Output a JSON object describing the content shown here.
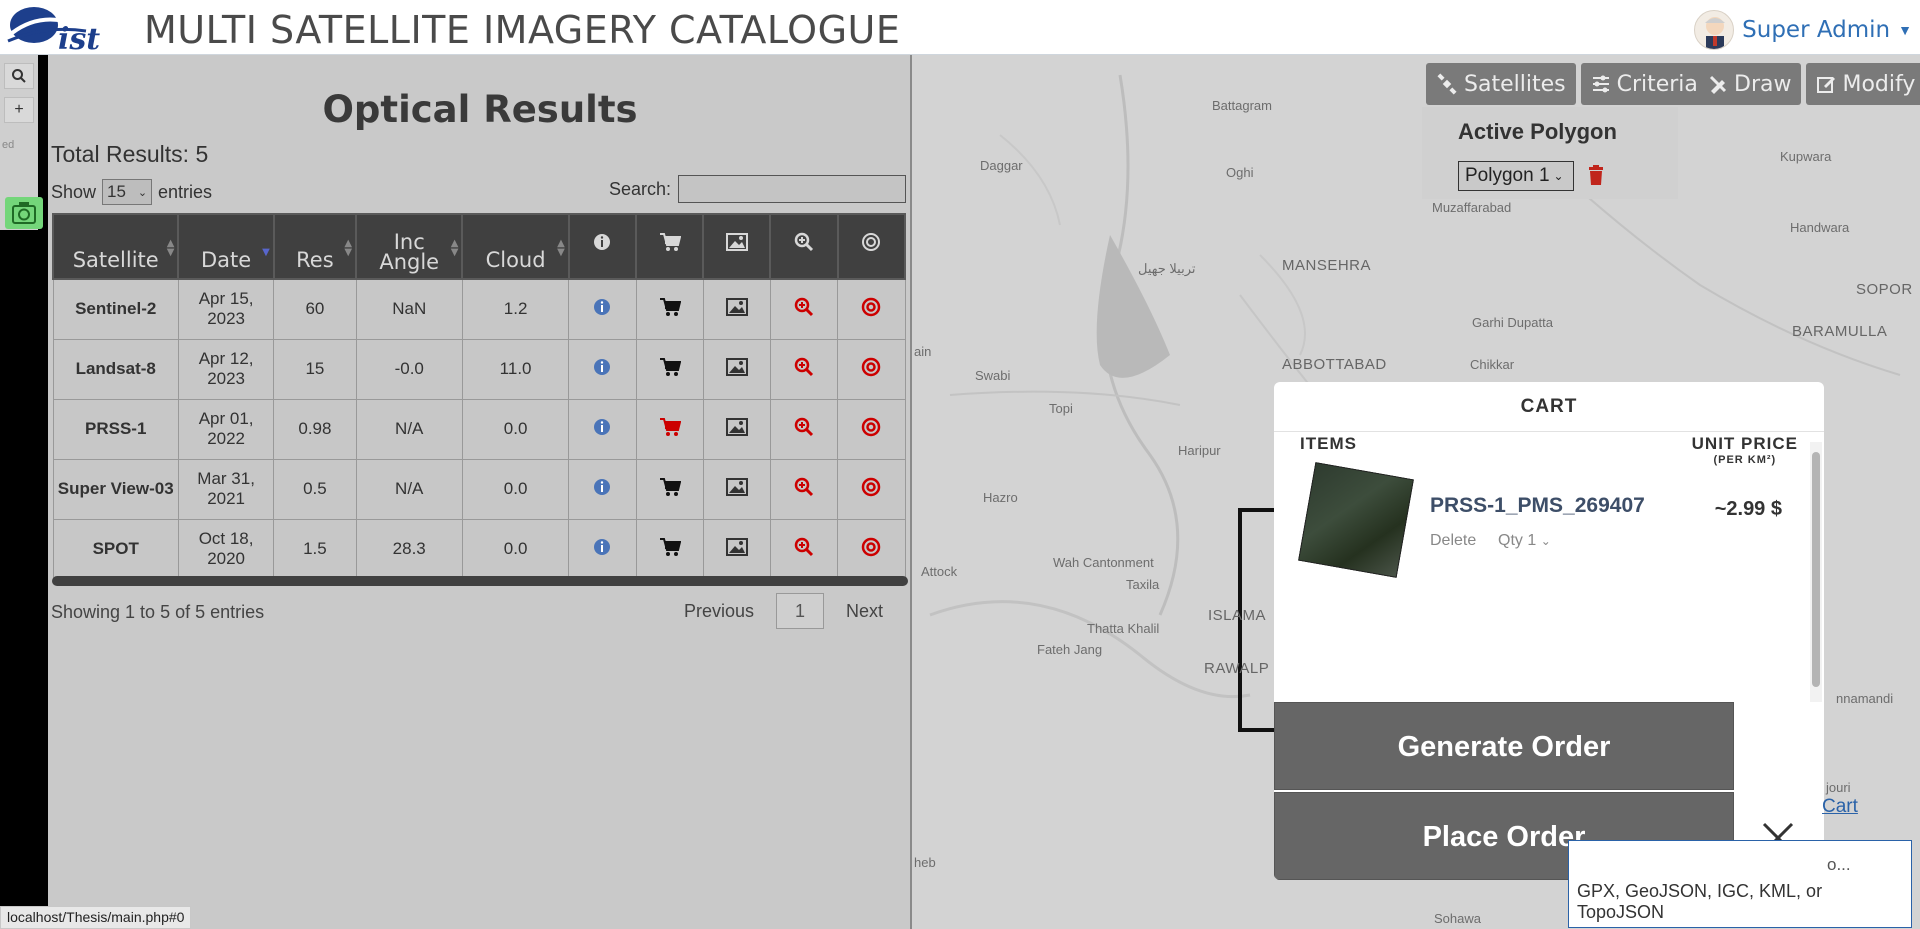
{
  "header": {
    "app_title": "MULTI SATELLITE IMAGERY CATALOGUE",
    "user_name": "Super Admin"
  },
  "map": {
    "place_labels": [
      {
        "text": "Battagram",
        "style": "small"
      },
      {
        "text": "Daggar",
        "style": "small"
      },
      {
        "text": "Oghi",
        "style": "small"
      },
      {
        "text": "Kupwara",
        "style": "small"
      },
      {
        "text": "Handwara",
        "style": "small"
      },
      {
        "text": "Muzaffarabad",
        "style": "small"
      },
      {
        "text": "MANSEHRA",
        "style": "big"
      },
      {
        "text": "Garhi Dupatta",
        "style": "small"
      },
      {
        "text": "SOPOR",
        "style": "big"
      },
      {
        "text": "BARAMULLA",
        "style": "big"
      },
      {
        "text": "ABBOTTABAD",
        "style": "big"
      },
      {
        "text": "Chikkar",
        "style": "small"
      },
      {
        "text": "Swabi",
        "style": "small"
      },
      {
        "text": "Topi",
        "style": "small"
      },
      {
        "text": "Haripur",
        "style": "small"
      },
      {
        "text": "Hazro",
        "style": "small"
      },
      {
        "text": "Attock",
        "style": "small"
      },
      {
        "text": "Wah Cantonment",
        "style": "small"
      },
      {
        "text": "Taxila",
        "style": "small"
      },
      {
        "text": "ISLAMA",
        "style": "big"
      },
      {
        "text": "RAWALP",
        "style": "big"
      },
      {
        "text": "Thatta Khalil",
        "style": "small"
      },
      {
        "text": "Fateh Jang",
        "style": "small"
      },
      {
        "text": "Sohawa",
        "style": "small"
      },
      {
        "text": "nnamandi",
        "style": "small"
      },
      {
        "text": "jouri",
        "style": "small"
      },
      {
        "text": "ain",
        "style": "small"
      },
      {
        "text": "heb",
        "style": "small"
      },
      {
        "text": "تربیلا جھیل",
        "style": "small"
      }
    ],
    "zoom_in_label": "+",
    "attribution_fragment": "ed"
  },
  "toolbar": {
    "satellites": "Satellites",
    "criteria": "Criteria",
    "draw": "Draw",
    "modify": "Modify"
  },
  "active_polygon": {
    "title": "Active Polygon",
    "selected": "Polygon 1"
  },
  "results": {
    "title": "Optical Results",
    "total": "Total Results: 5",
    "show_label": "Show",
    "entries_value": "15",
    "entries_label": "entries",
    "search_label": "Search:",
    "columns": [
      "Satellite",
      "Date",
      "Res",
      "Inc Angle",
      "Cloud"
    ],
    "icon_columns": [
      "info-icon",
      "cart-icon",
      "image-icon",
      "zoom-icon",
      "target-icon"
    ],
    "rows": [
      {
        "satellite": "Sentinel-2",
        "date": "Apr 15, 2023",
        "res": "60",
        "inc": "NaN",
        "cloud": "1.2",
        "in_cart": false
      },
      {
        "satellite": "Landsat-8",
        "date": "Apr 12, 2023",
        "res": "15",
        "inc": "-0.0",
        "cloud": "11.0",
        "in_cart": false
      },
      {
        "satellite": "PRSS-1",
        "date": "Apr 01, 2022",
        "res": "0.98",
        "inc": "N/A",
        "cloud": "0.0",
        "in_cart": true
      },
      {
        "satellite": "Super View-03",
        "date": "Mar 31, 2021",
        "res": "0.5",
        "inc": "N/A",
        "cloud": "0.0",
        "in_cart": false
      },
      {
        "satellite": "SPOT",
        "date": "Oct 18, 2020",
        "res": "1.5",
        "inc": "28.3",
        "cloud": "0.0",
        "in_cart": false
      }
    ],
    "showing": "Showing 1 to 5 of 5 entries",
    "previous": "Previous",
    "page": "1",
    "next": "Next"
  },
  "cart": {
    "title": "CART",
    "items_header": "ITEMS",
    "price_header": "UNIT PRICE",
    "price_sub": "(PER KM²)",
    "item": {
      "name": "PRSS-1_PMS_269407",
      "delete": "Delete",
      "qty": "Qty 1",
      "price": "~2.99 $"
    },
    "generate_order": "Generate Order",
    "place_order": "Place Order",
    "link": "Cart"
  },
  "tooltip": {
    "line1": "o...",
    "line2": "GPX, GeoJSON, IGC, KML, or TopoJSON"
  },
  "status_url": "localhost/Thesis/main.php#0",
  "colors": {
    "header_blue": "#2f6fb5",
    "cart_red": "#cc0000",
    "info_blue": "#4a74b8",
    "overlay_gray": "#c9c9c9"
  }
}
